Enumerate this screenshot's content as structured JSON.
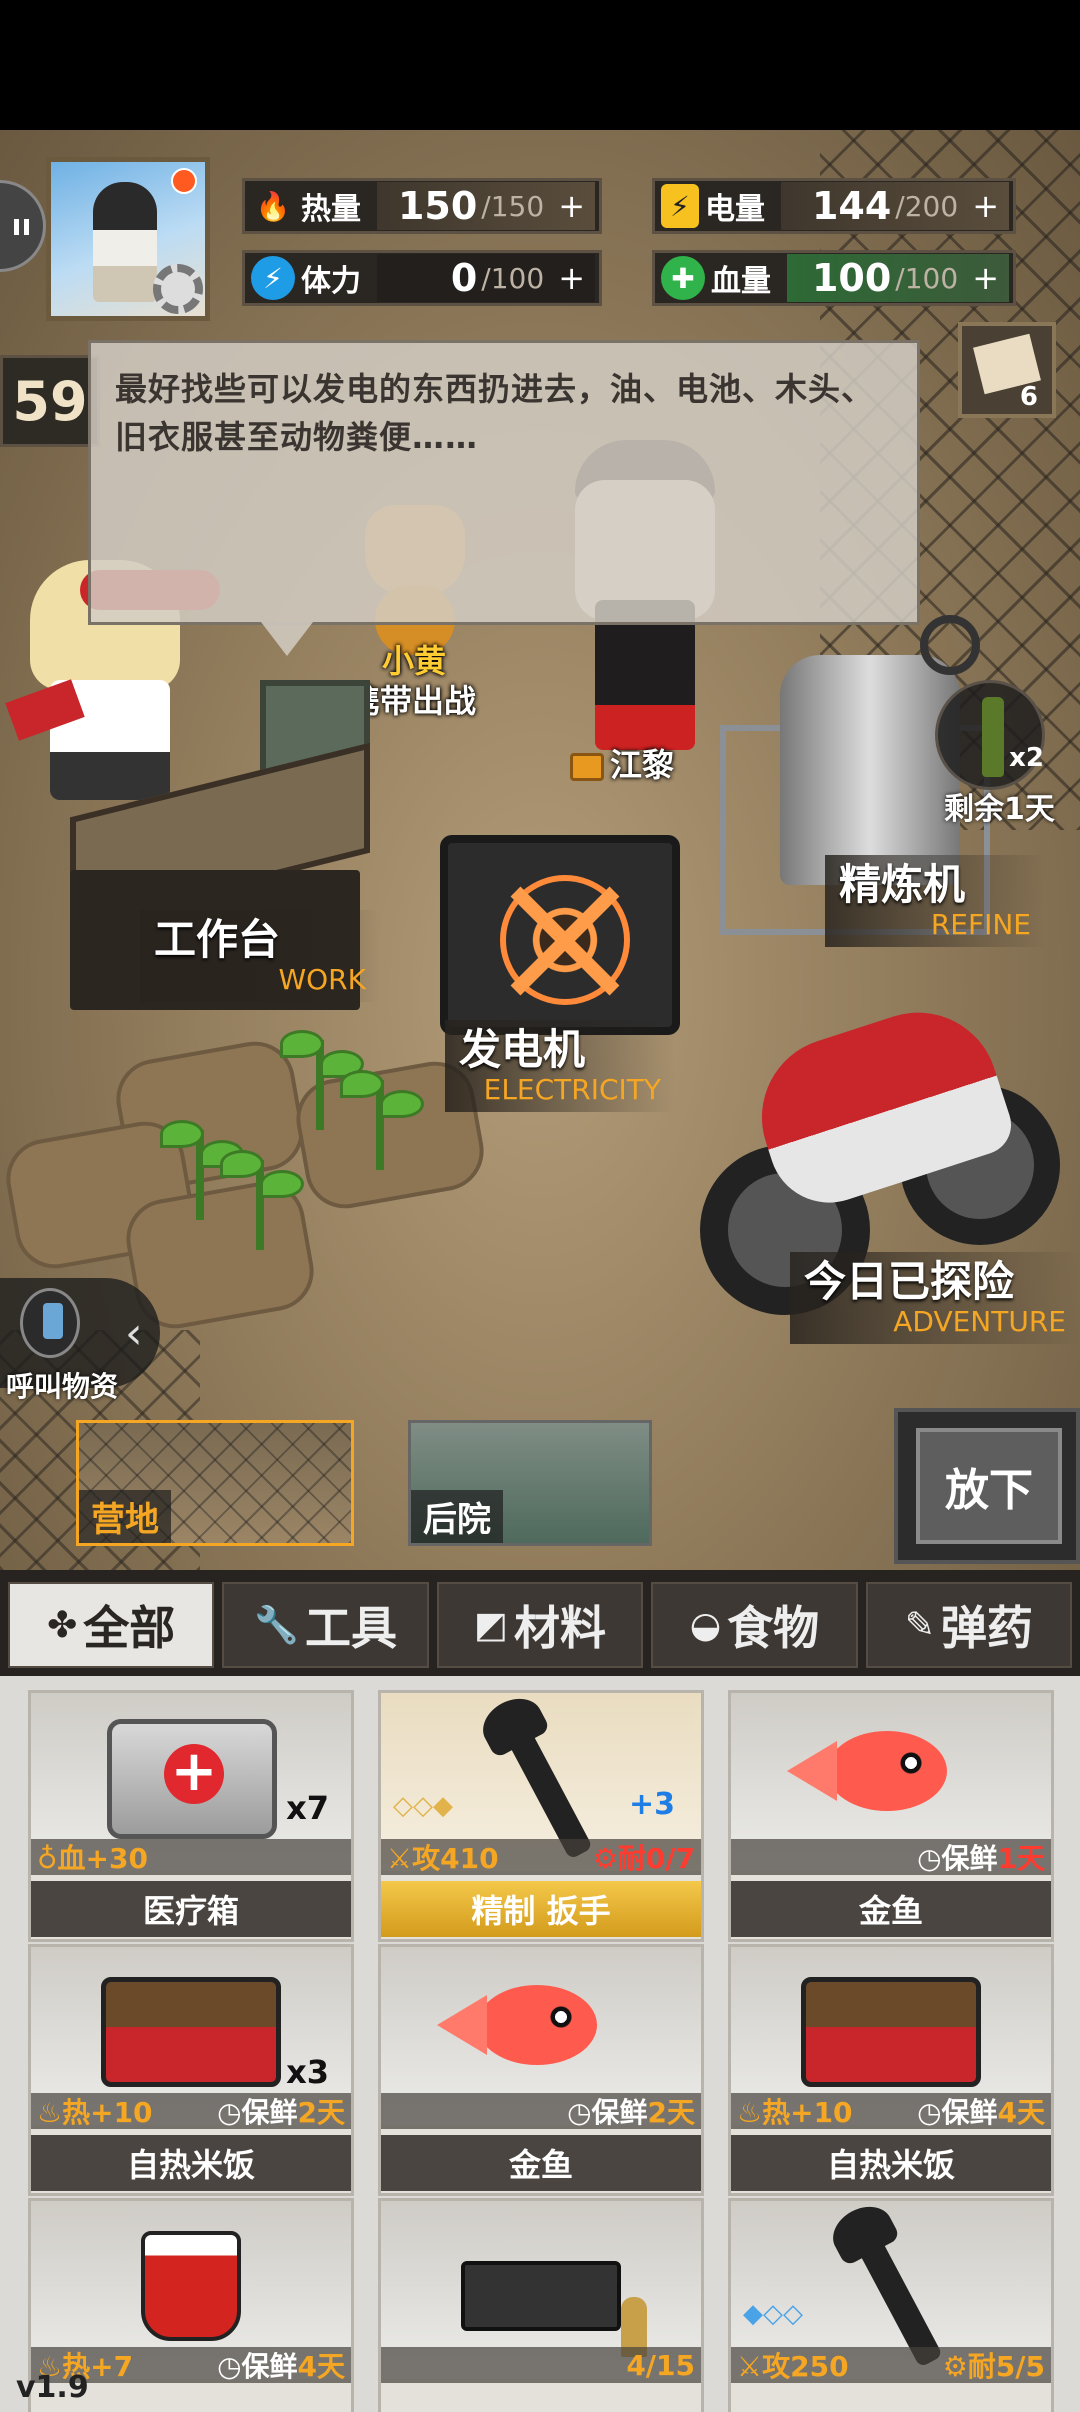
{
  "profile": {
    "avatar_alt": "player-avatar"
  },
  "stats": {
    "heat": {
      "label": "热量",
      "current": "150",
      "max": "/150",
      "plus": "+"
    },
    "power": {
      "label": "电量",
      "current": "144",
      "max": "/200",
      "plus": "+"
    },
    "stamina": {
      "label": "体力",
      "current": "0",
      "max": "/100",
      "plus": "+"
    },
    "health": {
      "label": "血量",
      "current": "100",
      "max": "/100",
      "plus": "+"
    }
  },
  "day": "59",
  "dialog": {
    "text": "最好找些可以发电的东西扔进去，油、电池、木头、旧衣服甚至动物粪便……"
  },
  "mail": {
    "count": "6"
  },
  "characters": {
    "cat_name": "小黄",
    "cat_action": "携带出战",
    "officer_name": "江黎"
  },
  "buildings": {
    "workbench": {
      "cn": "工作台",
      "en": "WORK"
    },
    "generator": {
      "cn": "发电机",
      "en": "ELECTRICITY"
    },
    "refine": {
      "cn": "精炼机",
      "en": "REFINE"
    },
    "adventure": {
      "cn": "今日已探险",
      "en": "ADVENTURE"
    }
  },
  "refine_item": {
    "count": "x2",
    "remaining": "剩余1天"
  },
  "call_supply": "呼叫物资",
  "locations": [
    {
      "label": "营地",
      "active": true
    },
    {
      "label": "后院",
      "active": false
    }
  ],
  "drop_button": "放下",
  "tabs": [
    {
      "icon": "✤",
      "label": "全部",
      "active": true
    },
    {
      "icon": "🔧",
      "label": "工具",
      "active": false
    },
    {
      "icon": "◩",
      "label": "材料",
      "active": false
    },
    {
      "icon": "◒",
      "label": "食物",
      "active": false
    },
    {
      "icon": "✎",
      "label": "弹药",
      "active": false
    }
  ],
  "inventory": [
    {
      "name": "医疗箱",
      "qty": "x7",
      "left": "♁血+30",
      "right": ""
    },
    {
      "name": "精制 扳手",
      "upgrade": "+3",
      "diamonds": "◇◇◆",
      "left": "⚔攻410",
      "right": "⚙耐0/7"
    },
    {
      "name": "金鱼",
      "left": "",
      "right_label": "◷保鲜",
      "right_value": "1天"
    },
    {
      "name": "自热米饭",
      "qty": "x3",
      "left": "♨热+10",
      "right_label": "◷保鲜",
      "right_value": "2天"
    },
    {
      "name": "金鱼",
      "left": "",
      "right_label": "◷保鲜",
      "right_value": "2天"
    },
    {
      "name": "自热米饭",
      "left": "♨热+10",
      "right_label": "◷保鲜",
      "right_value": "4天"
    },
    {
      "name": "",
      "left": "♨热+7",
      "right_label": "◷保鲜",
      "right_value": "4天"
    },
    {
      "name": "",
      "left": "",
      "right": "4/15"
    },
    {
      "name": "",
      "diamonds": "◆◇◇",
      "left": "⚔攻250",
      "right": "⚙耐5/5"
    }
  ],
  "version": "v1.9",
  "colors": {
    "accent": "#f5a623",
    "danger": "#ff3b30",
    "heat": "#e8402a",
    "power": "#f7c21f",
    "stamina": "#1e9ce6",
    "health": "#2fb34a"
  }
}
